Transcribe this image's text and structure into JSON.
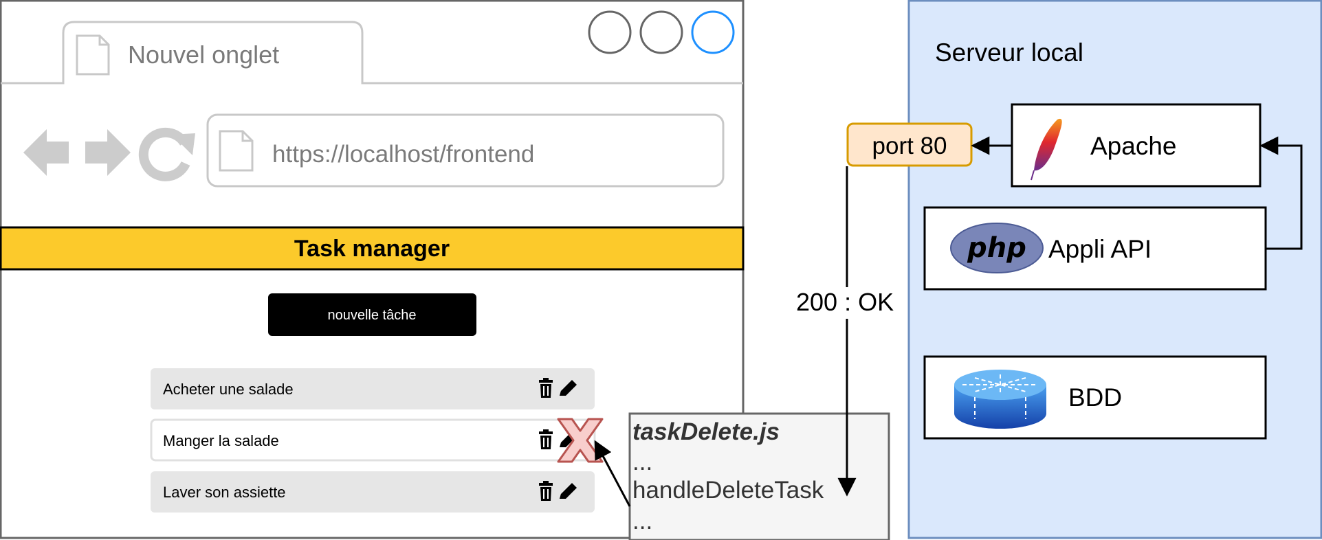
{
  "browser": {
    "tab_title": "Nouvel onglet",
    "url": "https://localhost/frontend"
  },
  "app": {
    "title": "Task manager",
    "new_task_button": "nouvelle tâche",
    "tasks": [
      {
        "label": "Acheter une salade"
      },
      {
        "label": "Manger la salade"
      },
      {
        "label": "Laver son assiette"
      }
    ]
  },
  "code_box": {
    "filename": "taskDelete.js",
    "lines": [
      "...",
      "handleDeleteTask",
      "..."
    ]
  },
  "server": {
    "title": "Serveur local",
    "apache_label": "Apache",
    "api_label": "Appli API",
    "php_logo_text": "php",
    "db_label": "BDD",
    "port_label": "port 80",
    "response_label": "200 : OK"
  },
  "colors": {
    "banner": "#FCCA2B",
    "server_bg": "#DAE8FC",
    "server_border": "#6C8EBF",
    "port_bg": "#FFE6CC",
    "port_border": "#D79B00",
    "delete_mark": "#F8CECC",
    "delete_mark_border": "#B85450",
    "task_row": "#E6E6E6",
    "browser_chrome": "#666666",
    "window_button_active": "#1E90FF"
  },
  "icons": [
    "document-icon",
    "back-arrow-icon",
    "forward-arrow-icon",
    "reload-icon",
    "trash-icon",
    "pencil-icon",
    "delete-x-icon",
    "apache-feather-icon",
    "php-logo-icon",
    "database-icon"
  ]
}
